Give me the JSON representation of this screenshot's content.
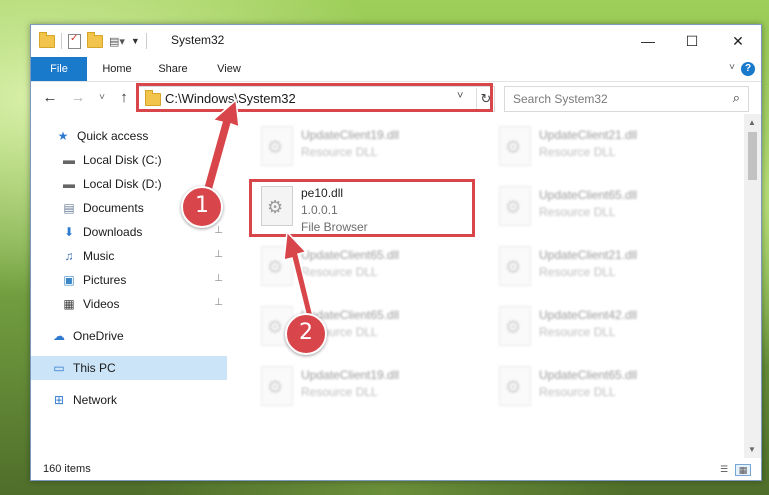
{
  "window": {
    "title": "System32",
    "minimize_glyph": "—",
    "maximize_glyph": "☐",
    "close_glyph": "✕"
  },
  "ribbon": {
    "tabs": [
      "File",
      "Home",
      "Share",
      "View"
    ],
    "help_glyph": "?",
    "collapse_glyph": "˅"
  },
  "nav_buttons": {
    "back": "←",
    "forward": "→",
    "recent": "˅",
    "up": "↑"
  },
  "address": {
    "path": "C:\\Windows\\System32",
    "dropdown_glyph": "˅",
    "refresh_glyph": "↻"
  },
  "search": {
    "placeholder": "Search System32",
    "icon_glyph": "⌕"
  },
  "sidebar": {
    "items": [
      {
        "label": "Quick access",
        "icon": "star-icon",
        "glyph": "★",
        "color": "#2e7ad1"
      },
      {
        "label": "Local Disk (C:)",
        "icon": "drive-icon",
        "glyph": "▬",
        "color": "#666666",
        "pinned": false
      },
      {
        "label": "Local Disk (D:)",
        "icon": "drive-icon",
        "glyph": "▬",
        "color": "#666666",
        "pinned": false
      },
      {
        "label": "Documents",
        "icon": "documents-icon",
        "glyph": "▤",
        "color": "#6b7f99",
        "pinned": true
      },
      {
        "label": "Downloads",
        "icon": "download-icon",
        "glyph": "⬇",
        "color": "#2e7ad1",
        "pinned": true
      },
      {
        "label": "Music",
        "icon": "music-icon",
        "glyph": "♫",
        "color": "#3b6fb5",
        "pinned": true
      },
      {
        "label": "Pictures",
        "icon": "pictures-icon",
        "glyph": "▣",
        "color": "#3b86c6",
        "pinned": true
      },
      {
        "label": "Videos",
        "icon": "videos-icon",
        "glyph": "▦",
        "color": "#444444",
        "pinned": true
      },
      {
        "label": "OneDrive",
        "icon": "cloud-icon",
        "glyph": "☁",
        "color": "#2e7ad1"
      },
      {
        "label": "This PC",
        "icon": "computer-icon",
        "glyph": "▭",
        "color": "#2e7ad1"
      },
      {
        "label": "Network",
        "icon": "network-icon",
        "glyph": "⊞",
        "color": "#2e7ad1"
      }
    ],
    "pin_glyph": "📌"
  },
  "files": {
    "left": [
      {
        "name": "UpdateClient19.dll",
        "type": "Resource DLL"
      },
      {
        "name": "pe10.dll",
        "version": "1.0.0.1",
        "type": "File Browser"
      },
      {
        "name": "UpdateClient65.dll",
        "type": "Resource DLL"
      },
      {
        "name": "UpdateClient65.dll",
        "type": "Resource DLL"
      },
      {
        "name": "UpdateClient19.dll",
        "type": "Resource DLL"
      }
    ],
    "right": [
      {
        "name": "UpdateClient21.dll",
        "type": "Resource DLL"
      },
      {
        "name": "UpdateClient65.dll",
        "type": "Resource DLL"
      },
      {
        "name": "UpdateClient21.dll",
        "type": "Resource DLL"
      },
      {
        "name": "UpdateClient42.dll",
        "type": "Resource DLL"
      },
      {
        "name": "UpdateClient65.dll",
        "type": "Resource DLL"
      }
    ]
  },
  "annotations": {
    "step1": "1",
    "step2": "2",
    "color": "#d8454a"
  },
  "status": {
    "item_count": "160 items"
  }
}
